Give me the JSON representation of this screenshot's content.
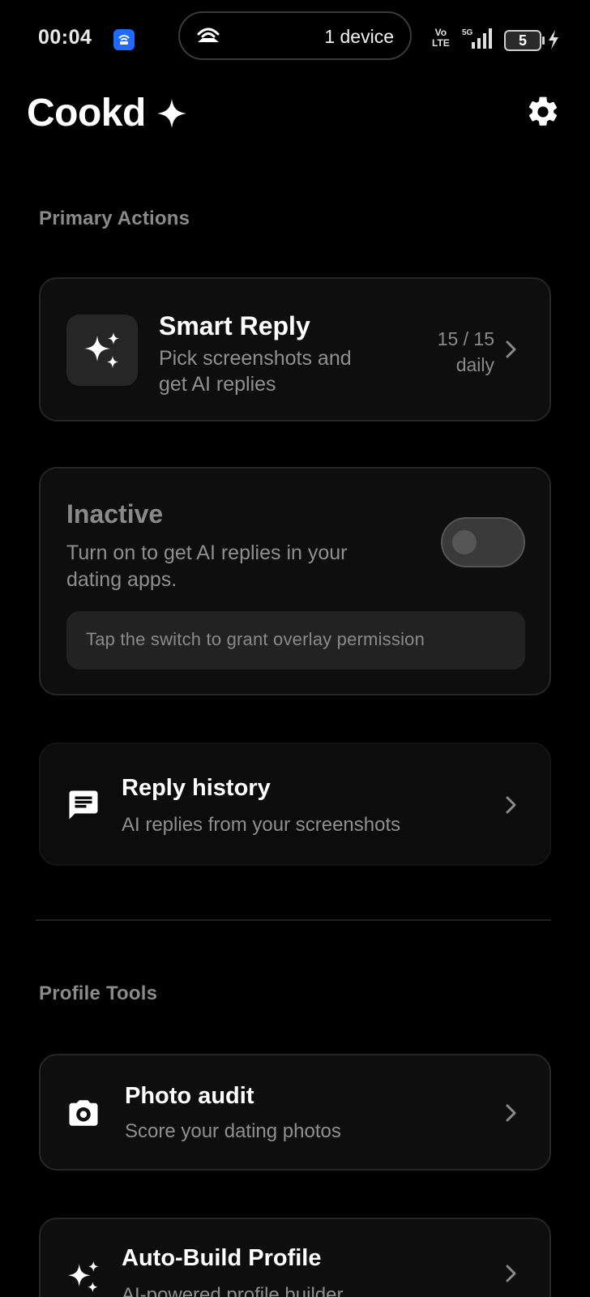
{
  "status_bar": {
    "time": "00:04",
    "pill_text": "1 device",
    "volte_top": "Vo",
    "volte_bottom": "LTE",
    "network": "5G",
    "battery": "5"
  },
  "header": {
    "title": "Cookd"
  },
  "primary_section": {
    "label": "Primary Actions"
  },
  "smart_reply": {
    "title": "Smart Reply",
    "subtitle_line1": "Pick screenshots and",
    "subtitle_line2": "get AI replies",
    "quota": "15 / 15",
    "quota_unit": "daily"
  },
  "overlay": {
    "status": "Inactive",
    "description_line1": "Turn on to get AI replies in your",
    "description_line2": "dating apps.",
    "hint": "Tap the switch to grant overlay permission",
    "enabled": false
  },
  "reply_history": {
    "title": "Reply history",
    "subtitle": "AI replies from your screenshots"
  },
  "profile_section": {
    "label": "Profile Tools"
  },
  "photo_audit": {
    "title": "Photo audit",
    "subtitle": "Score your dating photos"
  },
  "auto_build": {
    "title": "Auto-Build Profile",
    "subtitle": "AI-powered profile builder"
  },
  "colors": {
    "background": "#000000",
    "card": "#0e0e0e",
    "muted_text": "#8a8a8a",
    "accent_badge": "#1e6bff"
  }
}
